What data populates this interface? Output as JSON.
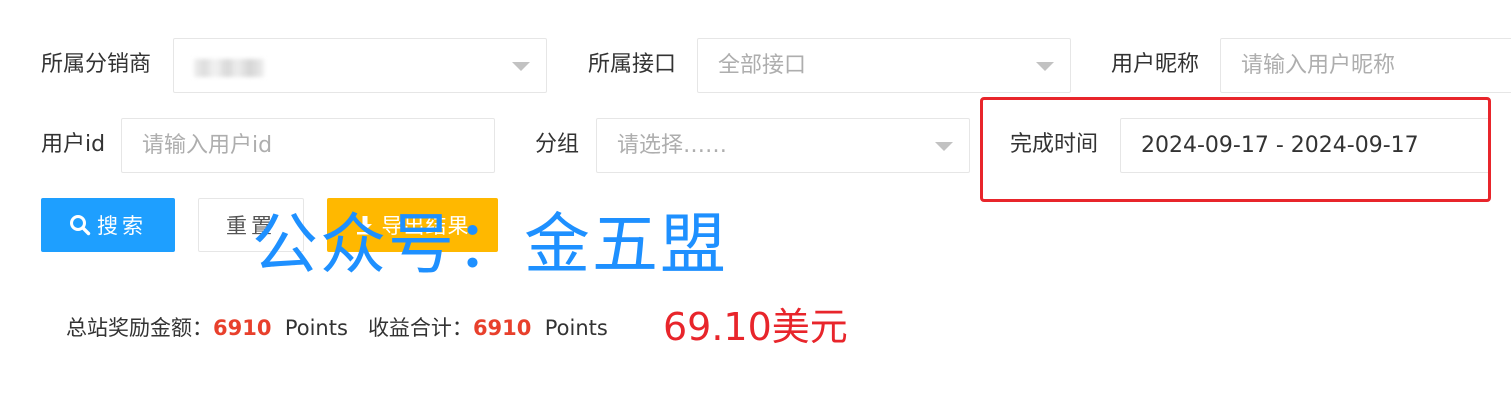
{
  "filters": {
    "distributor": {
      "label": "所属分销商",
      "value": ""
    },
    "interface": {
      "label": "所属接口",
      "placeholder": "全部接口"
    },
    "nickname": {
      "label": "用户昵称",
      "placeholder": "请输入用户昵称"
    },
    "user_id": {
      "label": "用户id",
      "placeholder": "请输入用户id"
    },
    "group": {
      "label": "分组",
      "placeholder": "请选择……"
    },
    "completion_time": {
      "label": "完成时间",
      "value": "2024-09-17 - 2024-09-17"
    }
  },
  "buttons": {
    "search_label": "搜索",
    "reset_label": "重置",
    "export_label": "导出结果"
  },
  "watermark": "公众号：金五盟",
  "summary": {
    "reward_label": "总站奖励金额：",
    "reward_value": "6910",
    "reward_unit": "Points",
    "income_label": "收益合计：",
    "income_value": "6910",
    "income_unit": "Points",
    "usd_amount": "69.10美元"
  },
  "colors": {
    "primary": "#1e9fff",
    "warning": "#ffb800",
    "highlight": "#e8252b",
    "value_red": "#e8402c"
  }
}
